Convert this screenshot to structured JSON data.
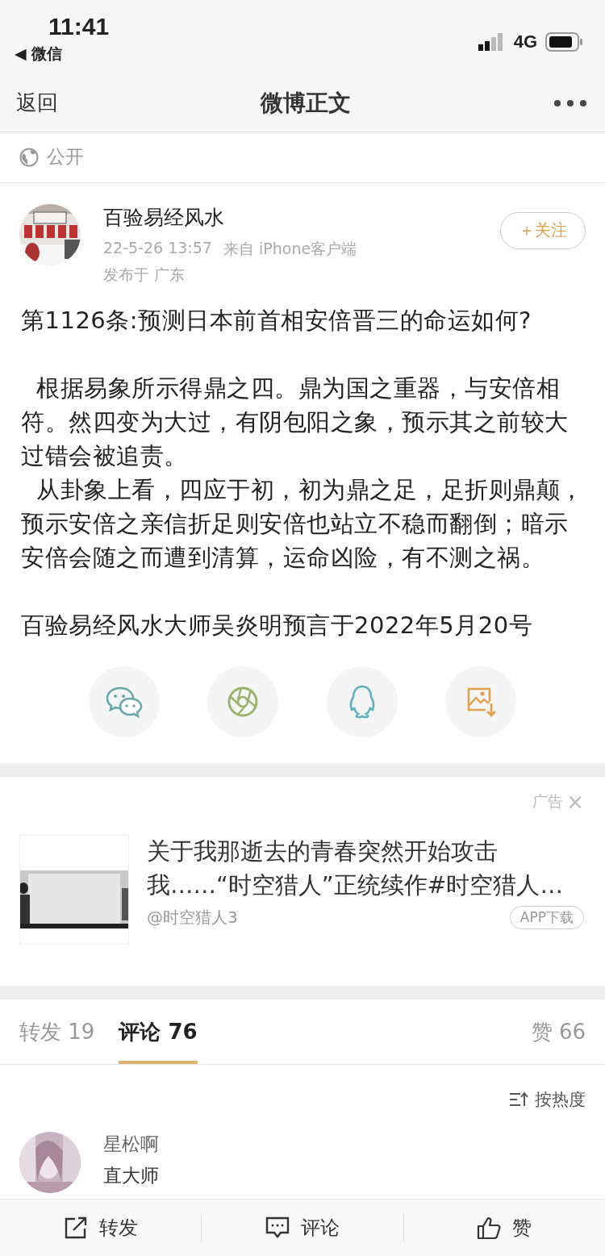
{
  "status_bar": {
    "time": "11:41",
    "back_app": "◀ 微信",
    "network": "4G"
  },
  "nav": {
    "back": "返回",
    "title": "微博正文"
  },
  "visibility": "公开",
  "post": {
    "author": "百验易经风水",
    "time": "22-5-26 13:57",
    "source": "来自 iPhone客户端",
    "location": "发布于 广东",
    "follow": "＋关注",
    "body_blocks": [
      [
        "第1126条:预测日本前首相安倍晋三的命运如何?"
      ],
      [
        "  根据易象所示得鼎之四。鼎为国之重器，与安倍相符。然四变为大过，有阴包阳之象，预示其之前较大过错会被追责。",
        "  从卦象上看，四应于初，初为鼎之足，足折则鼎颠，预示安倍之亲信折足则安倍也站立不稳而翻倒；暗示安倍会随之而遭到清算，运命凶险，有不测之祸。"
      ],
      [
        "百验易经风水大师吴炎明预言于2022年5月20号"
      ]
    ]
  },
  "share_buttons": [
    {
      "kind": "chat"
    },
    {
      "kind": "aperture"
    },
    {
      "kind": "penguin"
    },
    {
      "kind": "save-image"
    }
  ],
  "ad": {
    "label": "广告",
    "close": "×",
    "title": "关于我那逝去的青春突然开始攻击我……“时空猎人”正统续作#时空猎人…",
    "handle": "@时空猎人3",
    "action": "APP下载"
  },
  "tabs": [
    {
      "label": "转发 19",
      "selected": false
    },
    {
      "label": "评论 76",
      "selected": true
    },
    {
      "label": "赞 66",
      "selected": false
    }
  ],
  "sort": "按热度",
  "comments": [
    {
      "user": "星松啊",
      "text": "直大师"
    }
  ],
  "bottom_actions": [
    {
      "kind": "repost",
      "label": "转发"
    },
    {
      "kind": "comment",
      "label": "评论"
    },
    {
      "kind": "like",
      "label": "赞"
    }
  ]
}
